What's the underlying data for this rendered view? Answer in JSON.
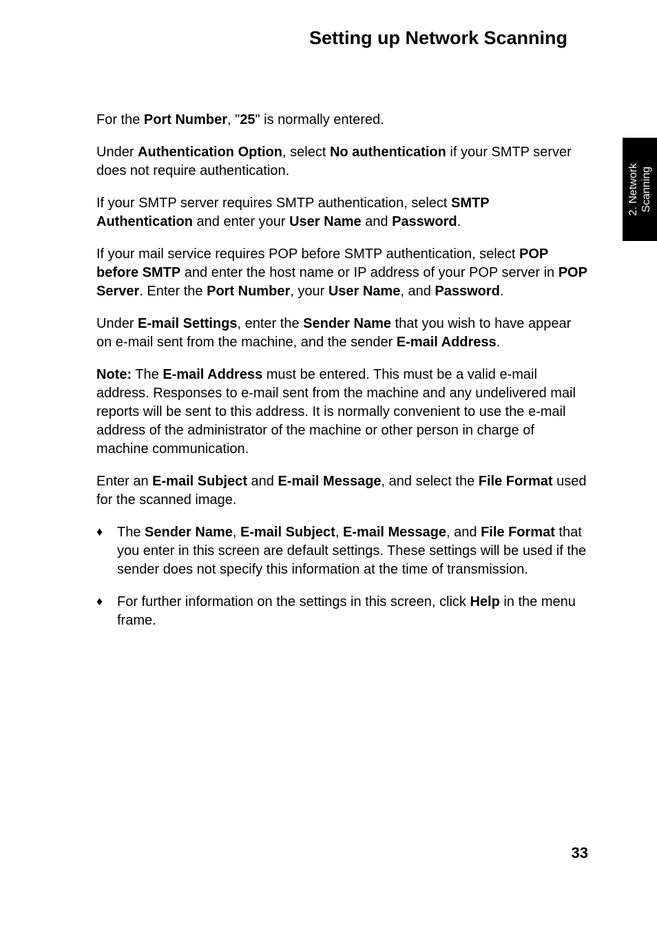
{
  "title": "Setting up Network Scanning",
  "sideTab": {
    "line1": "2. Network",
    "line2": "Scanning"
  },
  "paragraphs": {
    "p1_runs": [
      {
        "t": "For the "
      },
      {
        "t": "Port Number",
        "b": true
      },
      {
        "t": ", \""
      },
      {
        "t": "25",
        "b": true
      },
      {
        "t": "\" is normally entered."
      }
    ],
    "p2_runs": [
      {
        "t": "Under "
      },
      {
        "t": "Authentication Option",
        "b": true
      },
      {
        "t": ", select "
      },
      {
        "t": "No authentication",
        "b": true
      },
      {
        "t": " if your SMTP server does not require authentication."
      }
    ],
    "p3_runs": [
      {
        "t": "If your SMTP server requires SMTP authentication, select "
      },
      {
        "t": "SMTP Authentication",
        "b": true
      },
      {
        "t": " and enter your "
      },
      {
        "t": "User Name",
        "b": true
      },
      {
        "t": " and "
      },
      {
        "t": "Password",
        "b": true
      },
      {
        "t": "."
      }
    ],
    "p4_runs": [
      {
        "t": "If your mail service requires POP before SMTP authentication, select "
      },
      {
        "t": "POP before SMTP",
        "b": true
      },
      {
        "t": " and enter the host name or IP address of your POP server in "
      },
      {
        "t": "POP Server",
        "b": true
      },
      {
        "t": ". Enter the "
      },
      {
        "t": "Port Number",
        "b": true
      },
      {
        "t": ", your "
      },
      {
        "t": "User Name",
        "b": true
      },
      {
        "t": ", and "
      },
      {
        "t": "Password",
        "b": true
      },
      {
        "t": "."
      }
    ],
    "p5_runs": [
      {
        "t": "Under "
      },
      {
        "t": "E-mail Settings",
        "b": true
      },
      {
        "t": ", enter the "
      },
      {
        "t": "Sender Name",
        "b": true
      },
      {
        "t": " that you wish to have appear on e-mail sent from the machine, and the sender "
      },
      {
        "t": "E-mail Address",
        "b": true
      },
      {
        "t": "."
      }
    ],
    "p6_runs": [
      {
        "t": "Note:",
        "b": true
      },
      {
        "t": " The "
      },
      {
        "t": "E-mail Address",
        "b": true
      },
      {
        "t": " must be entered. This must be a valid e-mail address. Responses to e-mail sent from the machine and any undelivered mail reports will be sent to this address. It is normally convenient to use the e-mail address of the administrator of the machine or other person in charge of machine communication."
      }
    ],
    "p7_runs": [
      {
        "t": "Enter an "
      },
      {
        "t": "E-mail Subject",
        "b": true
      },
      {
        "t": " and "
      },
      {
        "t": "E-mail Message",
        "b": true
      },
      {
        "t": ", and select the "
      },
      {
        "t": "File Format",
        "b": true
      },
      {
        "t": " used for the scanned image."
      }
    ]
  },
  "bullets": {
    "b1_runs": [
      {
        "t": "The "
      },
      {
        "t": "Sender Name",
        "b": true
      },
      {
        "t": ", "
      },
      {
        "t": "E-mail Subject",
        "b": true
      },
      {
        "t": ", "
      },
      {
        "t": "E-mail Message",
        "b": true
      },
      {
        "t": ", and "
      },
      {
        "t": "File Format",
        "b": true
      },
      {
        "t": " that you enter in this screen are default settings. These settings will be used if the sender does not specify this information at the time of transmission."
      }
    ],
    "b2_runs": [
      {
        "t": "For further information on the settings in this screen, click "
      },
      {
        "t": "Help",
        "b": true
      },
      {
        "t": " in the menu frame."
      }
    ]
  },
  "bulletMarker": "♦",
  "pageNumber": "33"
}
